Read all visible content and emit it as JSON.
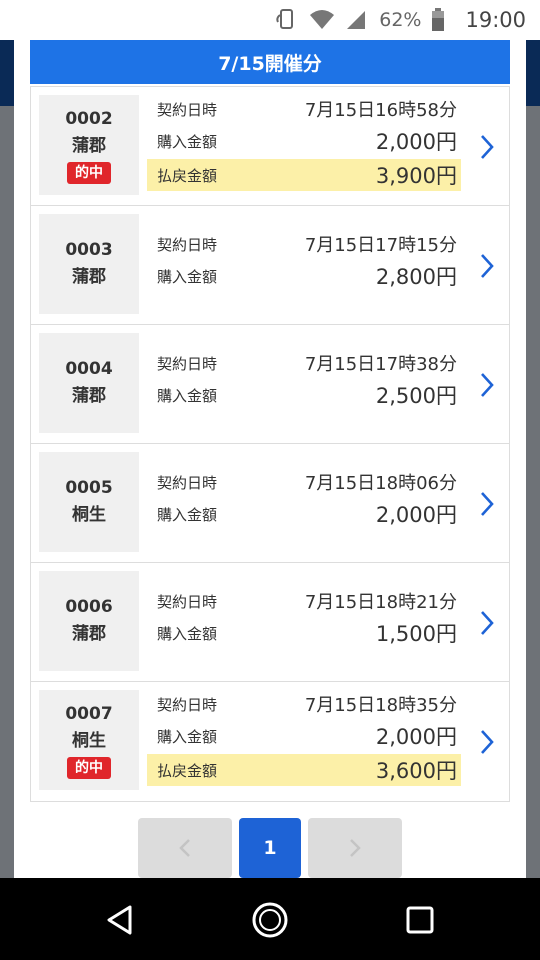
{
  "status_bar": {
    "battery_percent": "62%",
    "time": "19:00",
    "icons": [
      "nfc-icon",
      "wifi-icon",
      "signal-icon",
      "battery-icon"
    ]
  },
  "modal": {
    "title": "7/15開催分",
    "labels": {
      "contract": "契約日時",
      "purchase": "購入金額",
      "payout": "払戻金額",
      "hit_badge": "的中"
    },
    "items": [
      {
        "number": "0002",
        "venue": "蒲郡",
        "hit": true,
        "contract_time": "7月15日16時58分",
        "purchase": "2,000円",
        "payout": "3,900円"
      },
      {
        "number": "0003",
        "venue": "蒲郡",
        "hit": false,
        "contract_time": "7月15日17時15分",
        "purchase": "2,800円"
      },
      {
        "number": "0004",
        "venue": "蒲郡",
        "hit": false,
        "contract_time": "7月15日17時38分",
        "purchase": "2,500円"
      },
      {
        "number": "0005",
        "venue": "桐生",
        "hit": false,
        "contract_time": "7月15日18時06分",
        "purchase": "2,000円"
      },
      {
        "number": "0006",
        "venue": "蒲郡",
        "hit": false,
        "contract_time": "7月15日18時21分",
        "purchase": "1,500円"
      },
      {
        "number": "0007",
        "venue": "桐生",
        "hit": true,
        "contract_time": "7月15日18時35分",
        "purchase": "2,000円",
        "payout": "3,600円"
      }
    ]
  },
  "pagination": {
    "current_page": "1",
    "prev_icon": "chevron-left-icon",
    "next_icon": "chevron-right-icon"
  },
  "nav_bar": {
    "icons": [
      "back-icon",
      "home-icon",
      "recents-icon"
    ]
  },
  "colors": {
    "header_blue": "#1e73e6",
    "hit_red": "#e0262b",
    "payout_highlight": "#fcf0a8",
    "chevron_blue": "#1e63d6"
  }
}
